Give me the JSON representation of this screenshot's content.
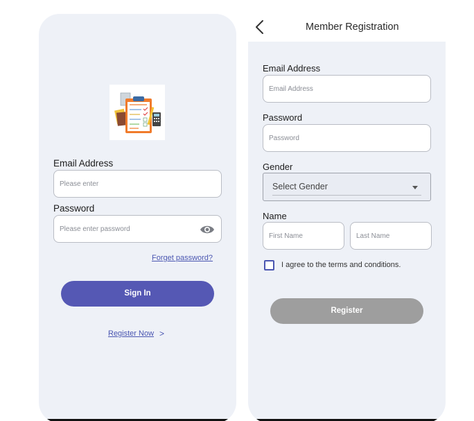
{
  "login": {
    "email_label": "Email Address",
    "email_placeholder": "Please enter",
    "password_label": "Password",
    "password_placeholder": "Please enter password",
    "forgot_link": "Forget password?",
    "sign_in_button": "Sign In",
    "register_link": "Register Now",
    "register_chevron": ">",
    "logo_icon": "checklist-clipboard-icon",
    "eye_icon": "eye-icon",
    "accent_color": "#5558b4",
    "link_color": "#4a56b1"
  },
  "registration": {
    "title": "Member Registration",
    "back_icon": "chevron-left-icon",
    "email_label": "Email Address",
    "email_placeholder": "Email Address",
    "password_label": "Password",
    "password_placeholder": "Password",
    "gender_label": "Gender",
    "gender_select_value": "Select Gender",
    "name_label": "Name",
    "first_name_placeholder": "First Name",
    "last_name_placeholder": "Last Name",
    "terms_text": "I agree to the terms and conditions.",
    "terms_checked": false,
    "register_button": "Register",
    "register_button_color": "#9e9e9e"
  },
  "background_color": "#eef1f7"
}
